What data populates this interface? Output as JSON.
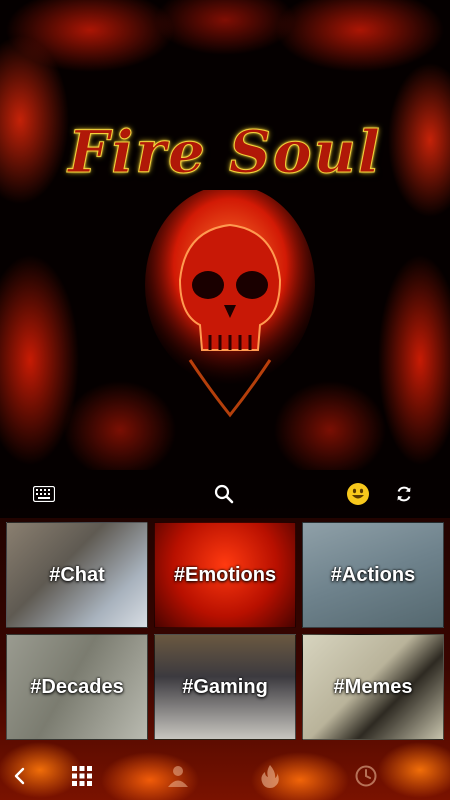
{
  "wallpaper": {
    "logo_text": "Fire Soul"
  },
  "toolbar": {
    "icons": [
      "keyboard-icon",
      "search-icon",
      "emoji-icon",
      "sync-icon"
    ]
  },
  "categories": [
    {
      "label": "#Chat"
    },
    {
      "label": "#Emotions"
    },
    {
      "label": "#Actions"
    },
    {
      "label": "#Decades"
    },
    {
      "label": "#Gaming"
    },
    {
      "label": "#Memes"
    }
  ],
  "bottombar": {
    "icons": [
      "back-arrow-icon",
      "grid-icon",
      "person-icon",
      "fire-icon",
      "clock-icon"
    ]
  },
  "colors": {
    "accent": "#d81b08",
    "fire": "#ff5a10",
    "logo_outline": "#f4d23a"
  }
}
